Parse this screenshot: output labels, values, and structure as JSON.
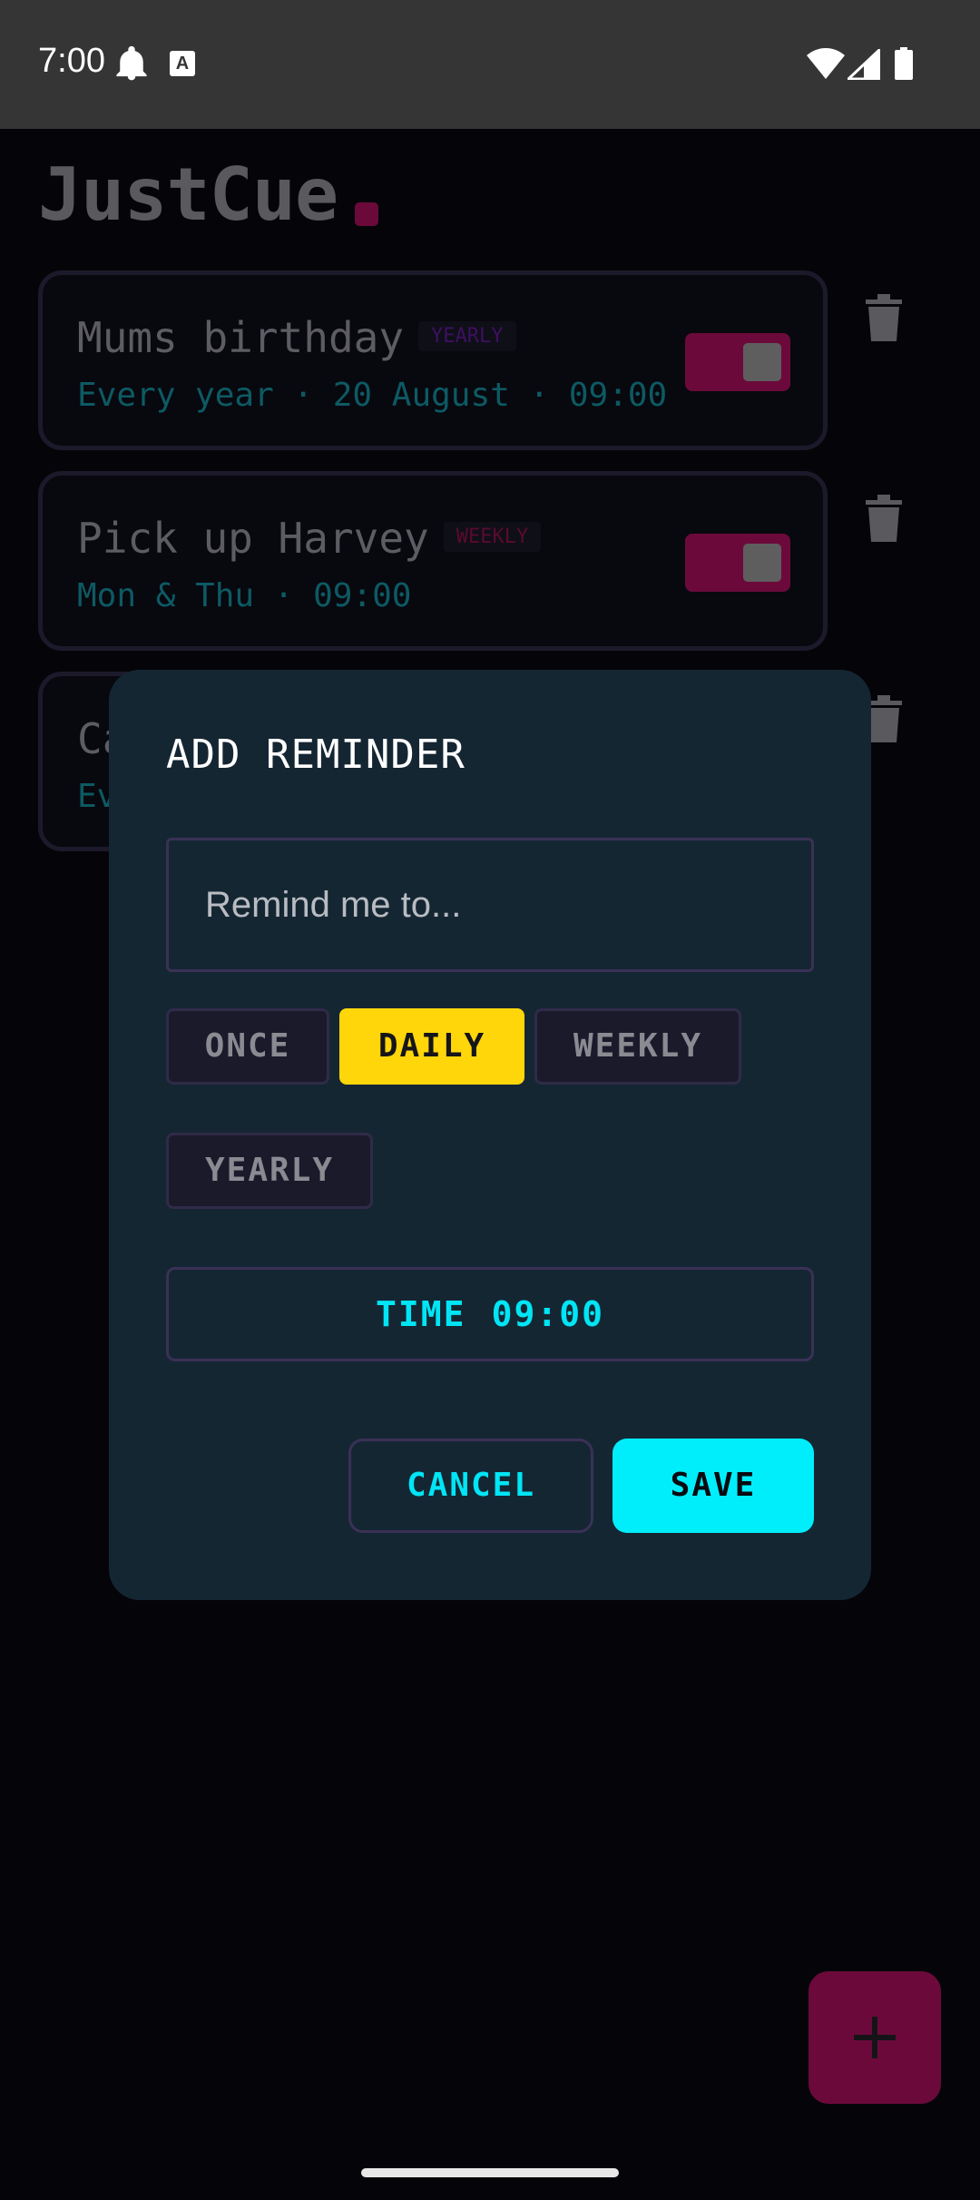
{
  "status_bar": {
    "time": "7:00",
    "icons": [
      "bell-icon",
      "text-a-icon",
      "wifi-icon",
      "signal-icon",
      "battery-icon"
    ]
  },
  "app": {
    "title": "JustCue",
    "accent_color": "#6b0a3a"
  },
  "reminders": [
    {
      "title": "Mums birthday",
      "badge": "YEARLY",
      "badge_color": "#3d1060",
      "subtitle": "Every year · 20 August · 09:00",
      "enabled": true
    },
    {
      "title": "Pick up Harvey",
      "badge": "WEEKLY",
      "badge_color": "#5a0a30",
      "subtitle": "Mon & Thu · 09:00",
      "enabled": true
    },
    {
      "title_visible": "Ca",
      "subtitle_visible": "Ev"
    }
  ],
  "dialog": {
    "title": "ADD REMINDER",
    "input_placeholder": "Remind me to...",
    "input_value": "",
    "frequency_options": [
      "ONCE",
      "DAILY",
      "WEEKLY",
      "YEARLY"
    ],
    "selected_frequency": "DAILY",
    "time_label": "TIME",
    "time_value": "09:00",
    "cancel_label": "CANCEL",
    "save_label": "SAVE",
    "selected_color": "#ffd60a",
    "action_color": "#00eefc"
  },
  "fab": {
    "icon": "plus-icon"
  }
}
